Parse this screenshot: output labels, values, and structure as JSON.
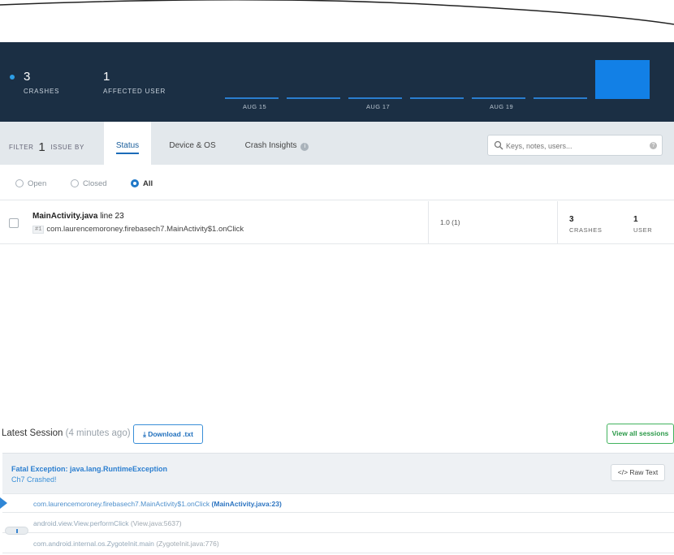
{
  "header": {
    "crashes_count": "3",
    "crashes_label": "CRASHES",
    "users_count": "1",
    "users_label": "AFFECTED USER",
    "timeline_ticks": [
      "AUG 15",
      "AUG 17",
      "AUG 19"
    ],
    "accent_color": "#1280e6"
  },
  "filter": {
    "prefix": "FILTER",
    "count": "1",
    "suffix": "ISSUE BY",
    "tabs": [
      {
        "label": "Status",
        "active": true
      },
      {
        "label": "Device & OS",
        "active": false
      },
      {
        "label": "Crash Insights",
        "active": false
      }
    ],
    "search_placeholder": "Keys, notes, users..."
  },
  "status_options": [
    {
      "label": "Open",
      "selected": false
    },
    {
      "label": "Closed",
      "selected": false
    },
    {
      "label": "All",
      "selected": true
    }
  ],
  "issue": {
    "file": "MainActivity.java",
    "line": "line 23",
    "hash": "#1",
    "method": "com.laurencemoroney.firebasech7.MainActivity$1.onClick",
    "version": "1.0 (1)",
    "crashes": "3",
    "crashes_label": "CRASHES",
    "users": "1",
    "users_label": "USER"
  },
  "session": {
    "title": "Latest Session",
    "ago": "(4 minutes ago)",
    "download_label": "Download .txt",
    "view_all_label": "View all sessions",
    "exception": "Fatal Exception: java.lang.RuntimeException",
    "message": "Ch7 Crashed!",
    "raw_label": "</> Raw Text",
    "frames": [
      {
        "method": "com.laurencemoroney.firebasech7.MainActivity$1.onClick",
        "location": "(MainActivity.java:23)"
      },
      {
        "method": "android.view.View.performClick",
        "location": "(View.java:5637)"
      },
      {
        "method": "com.android.internal.os.ZygoteInit.main",
        "location": "(ZygoteInit.java:776)"
      }
    ]
  }
}
